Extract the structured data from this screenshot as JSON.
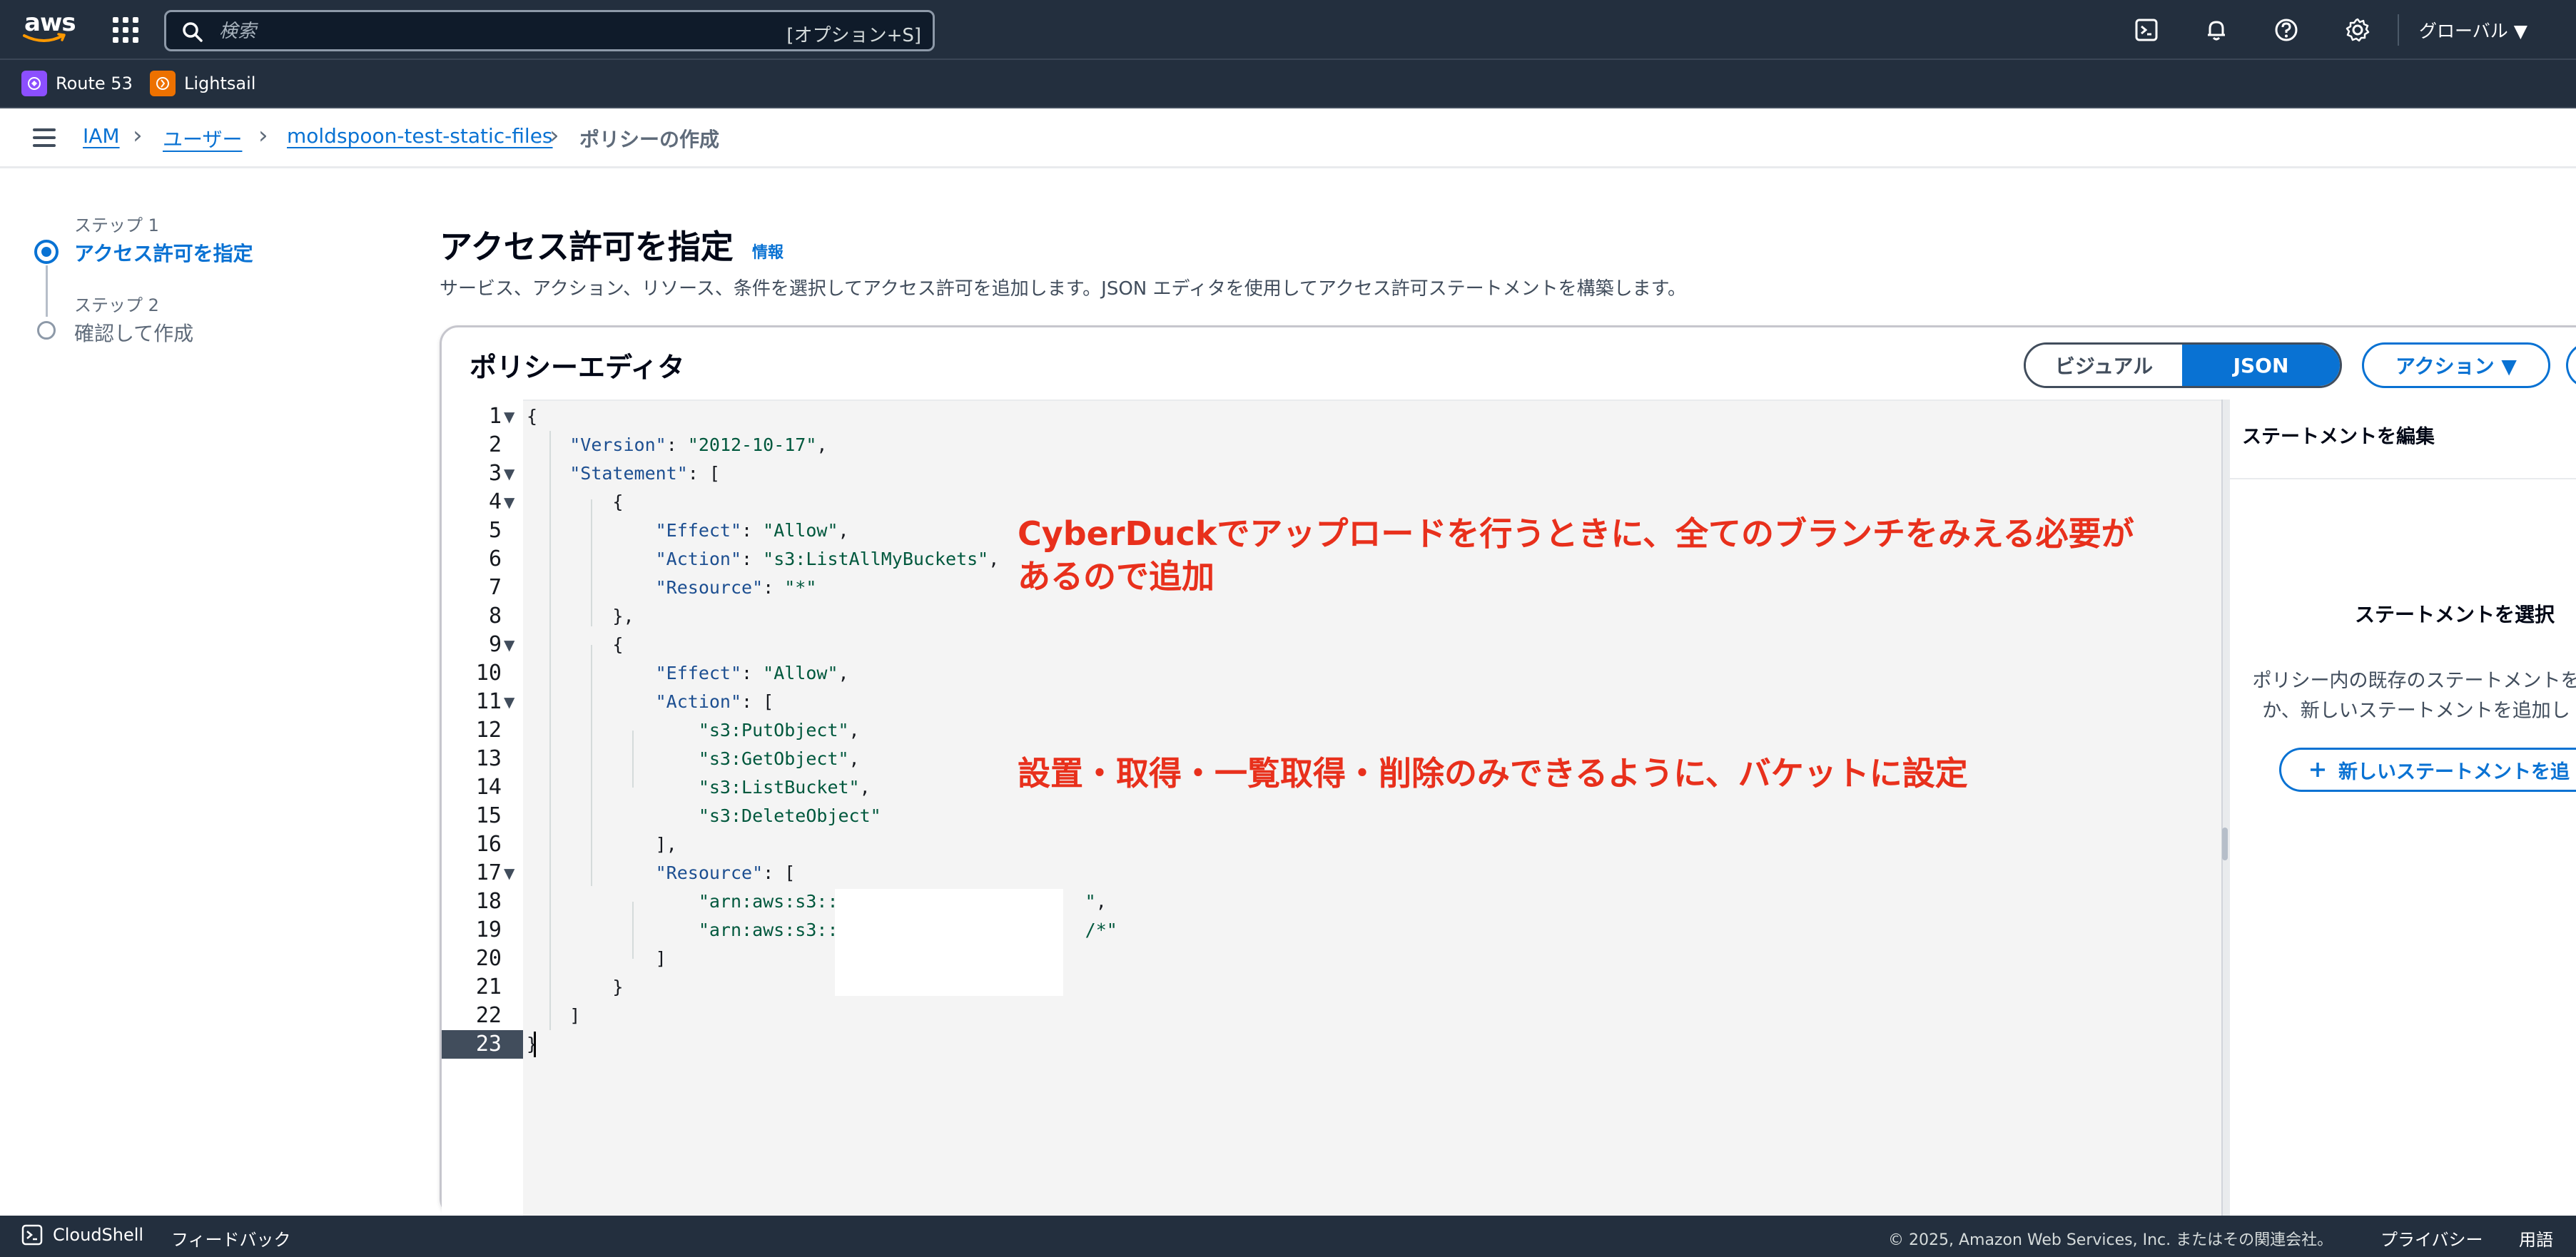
{
  "topnav": {
    "logo_text": "aws",
    "search_placeholder": "検索",
    "search_shortcut": "[オプション+S]",
    "region": "グローバル ▼",
    "icons": [
      "cloudshell-icon",
      "bell-icon",
      "help-icon",
      "gear-icon"
    ]
  },
  "favorites": [
    {
      "label": "Route 53",
      "color": "#8c4fff"
    },
    {
      "label": "Lightsail",
      "color": "#ed7100"
    }
  ],
  "breadcrumb": [
    {
      "label": "IAM"
    },
    {
      "label": "ユーザー"
    },
    {
      "label": "moldspoon-test-static-files"
    },
    {
      "label": "ポリシーの作成"
    }
  ],
  "steps": [
    {
      "label": "ステップ 1",
      "title": "アクセス許可を指定"
    },
    {
      "label": "ステップ 2",
      "title": "確認して作成"
    }
  ],
  "header": {
    "title": "アクセス許可を指定",
    "info": "情報",
    "description": "サービス、アクション、リソース、条件を選択してアクセス許可を追加します。JSON エディタを使用してアクセス許可ステートメントを構築します。"
  },
  "editor": {
    "title": "ポリシーエディタ",
    "mode_visual": "ビジュアル",
    "mode_json": "JSON",
    "actions_label": "アクション ▼",
    "active_line": 23,
    "lines": [
      "{",
      "    \"Version\": \"2012-10-17\",",
      "    \"Statement\": [",
      "        {",
      "            \"Effect\": \"Allow\",",
      "            \"Action\": \"s3:ListAllMyBuckets\",",
      "            \"Resource\": \"*\"",
      "        },",
      "        {",
      "            \"Effect\": \"Allow\",",
      "            \"Action\": [",
      "                \"s3:PutObject\",",
      "                \"s3:GetObject\",",
      "                \"s3:ListBucket\",",
      "                \"s3:DeleteObject\"",
      "            ],",
      "            \"Resource\": [",
      "                \"arn:aws:s3:::                      \",",
      "                \"arn:aws:s3:::                      /*\"",
      "            ]",
      "        }",
      "    ]",
      "}"
    ],
    "fold_lines": [
      1,
      3,
      4,
      9,
      11,
      17
    ]
  },
  "annotations": {
    "note1_line1": "CyberDuckでアップロードを行うときに、全てのブランチをみえる必要が",
    "note1_line2": "あるので追加",
    "note2": "設置・取得・一覧取得・削除のみできるように、バケットに設定"
  },
  "side_panel": {
    "header": "ステートメントを編集",
    "select_title": "ステートメントを選択",
    "desc_line1": "ポリシー内の既存のステートメントを",
    "desc_line2": "か、新しいステートメントを追加し",
    "new_button": "新しいステートメントを追"
  },
  "footer": {
    "cloudshell": "CloudShell",
    "feedback": "フィードバック",
    "copyright": "© 2025, Amazon Web Services, Inc. またはその関連会社。",
    "privacy": "プライバシー",
    "terms": "用語"
  },
  "colors": {
    "nav_bg": "#232f3e",
    "accent": "#0972d3",
    "annotation": "#e8301c"
  }
}
